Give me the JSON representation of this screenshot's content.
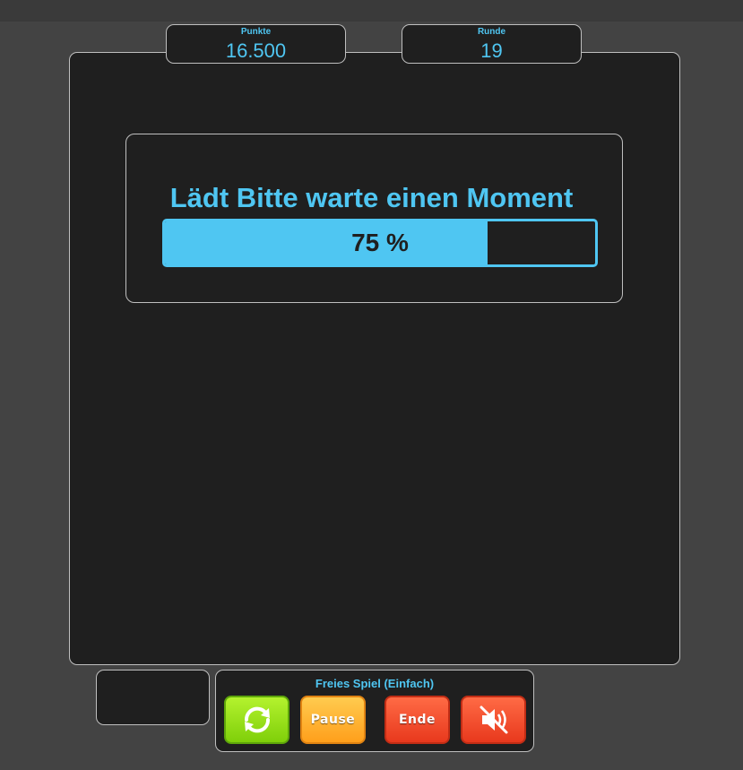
{
  "stats": {
    "points_label": "Punkte",
    "points_value": "16.500",
    "round_label": "Runde",
    "round_value": "19"
  },
  "loading": {
    "title": "Lädt Bitte warte einen Moment",
    "percent_text": "75 %",
    "progress_fraction": 0.75
  },
  "controls": {
    "mode_label": "Freies Spiel (Einfach)",
    "restart_icon": "restart-icon",
    "pause_label": "Pause",
    "end_label": "Ende",
    "mute_icon": "mute-icon"
  },
  "colors": {
    "accent": "#4fc6f2",
    "panel": "#1f1f1f",
    "background": "#434343",
    "restart": "#8fdc14",
    "pause": "#ffad2b",
    "end": "#f04a2a"
  }
}
